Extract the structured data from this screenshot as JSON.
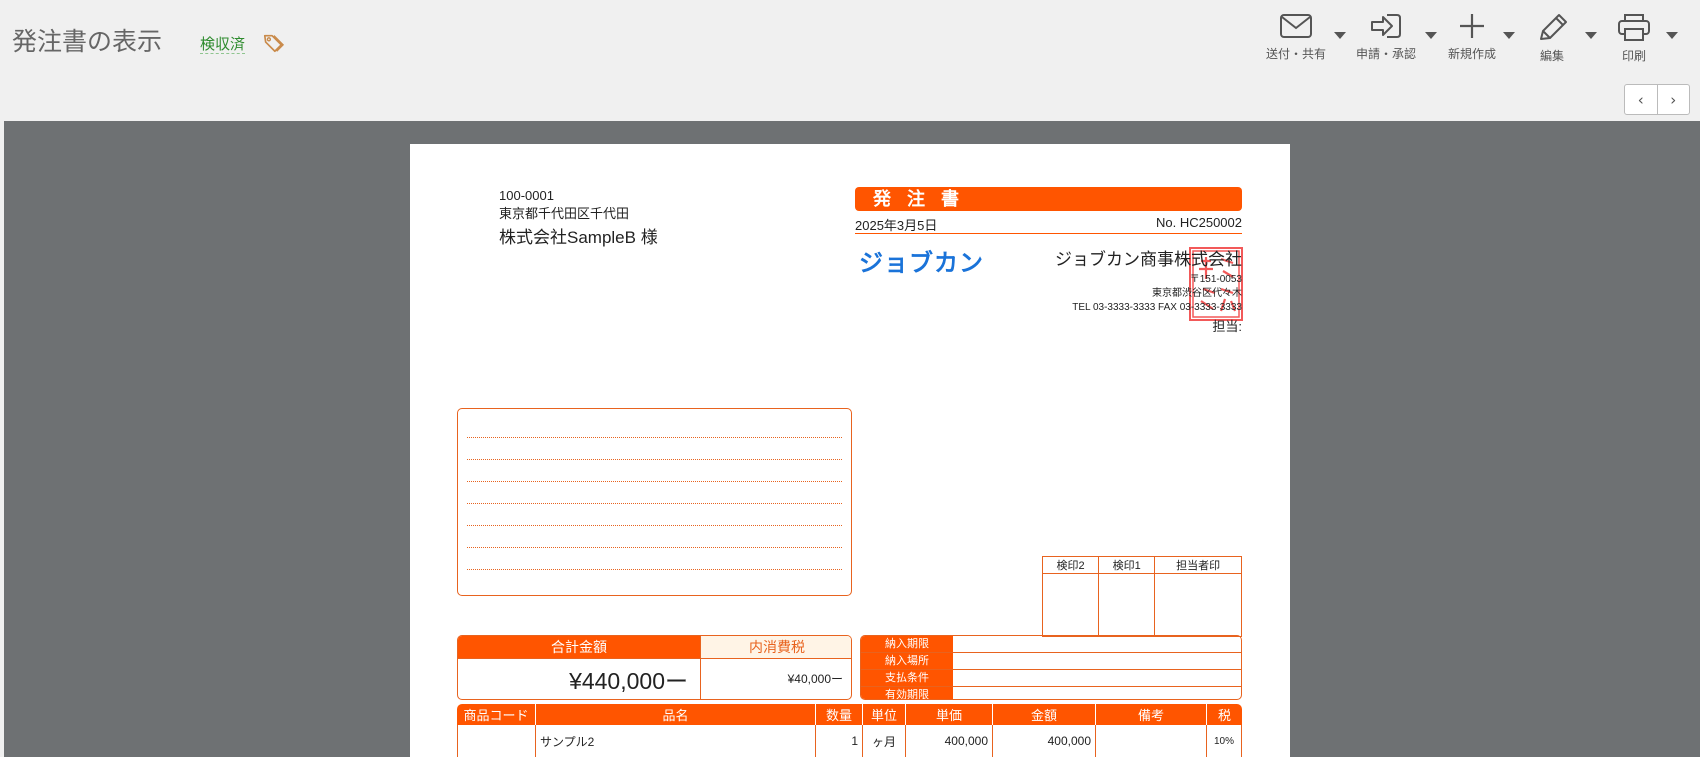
{
  "header": {
    "title": "発注書の表示",
    "status": "検収済",
    "tag_icon": "tag-icon"
  },
  "toolbar": {
    "send_share": "送付・共有",
    "apply_approve": "申請・承認",
    "new_create": "新規作成",
    "edit": "編集",
    "print": "印刷"
  },
  "pager": {
    "prev": "‹",
    "next": "›"
  },
  "document": {
    "recipient": {
      "zip": "100-0001",
      "address": "東京都千代田区千代田",
      "name": "株式会社SampleB 様"
    },
    "title": "発注書",
    "date": "2025年3月5日",
    "number": "No. HC250002",
    "logo": "ジョブカン",
    "company": {
      "name": "ジョブカン商事株式会社",
      "zip": "〒151-0053",
      "address": "東京都渋谷区代々木",
      "tel_fax": "TEL 03-3333-3333 FAX 03-3333-3333",
      "rep": "担当:"
    },
    "stamps": [
      "検印2",
      "検印1",
      "担当者印"
    ],
    "total_label": "合計金額",
    "total_value": "¥440,000ー",
    "tax_label": "内消費税",
    "tax_value": "¥40,000ー",
    "terms": [
      "納入期限",
      "納入場所",
      "支払条件",
      "有効期限"
    ],
    "items_header": [
      "商品コード",
      "品名",
      "数量",
      "単位",
      "単価",
      "金額",
      "備考",
      "税"
    ],
    "items": [
      {
        "code": "",
        "name": "サンプル2",
        "qty": "1",
        "unit": "ヶ月",
        "price": "400,000",
        "amount": "400,000",
        "note": "",
        "tax": "10%"
      }
    ],
    "colors": {
      "accent": "#ff5500",
      "logo": "#1a73d9",
      "seal": "#e22222"
    }
  }
}
